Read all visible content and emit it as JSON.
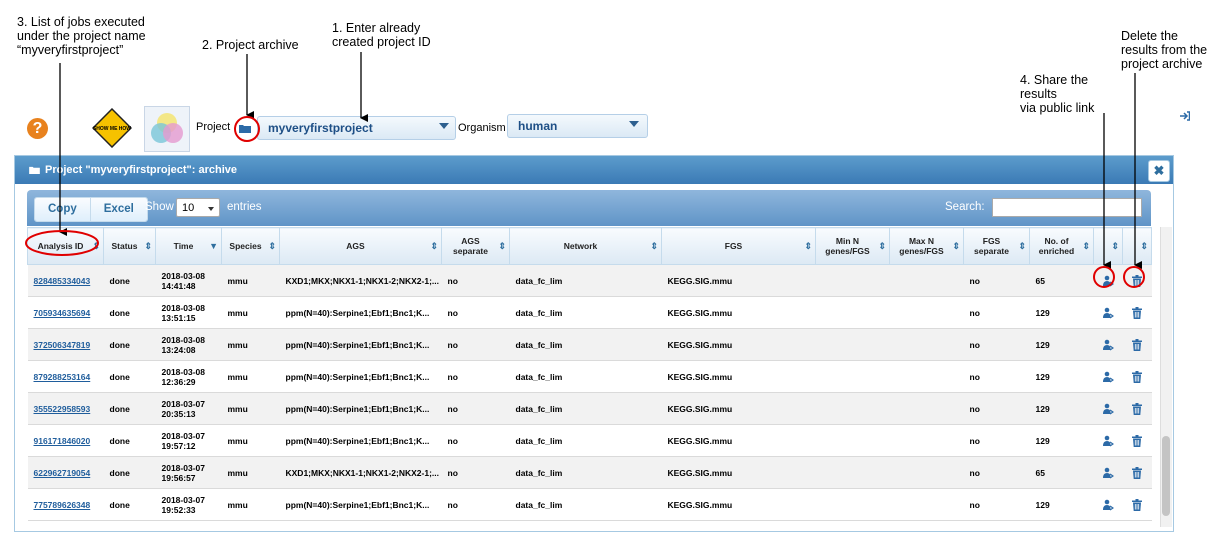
{
  "annotations": {
    "jobs_list": "3. List of jobs  executed\nunder the project name\n“myveryfirstproject”",
    "project_archive": "2. Project archive",
    "enter_id": "1. Enter already\ncreated project ID",
    "share": "4. Share the\nresults\nvia public link",
    "delete": "Delete the\nresults from the\nproject archive"
  },
  "header": {
    "help_glyph": "?",
    "showme_text": "SHOW ME HOW",
    "project_label": "Project",
    "project_value": "myveryfirstproject",
    "organism_label": "Organism",
    "organism_value": "human"
  },
  "dialog": {
    "title": "Project \"myveryfirstproject\": archive",
    "close_glyph": "✖",
    "copy_label": "Copy",
    "excel_label": "Excel",
    "show_label": "Show",
    "page_length": "10",
    "entries_label": "entries",
    "search_label": "Search:",
    "columns": [
      "Analysis ID",
      "Status",
      "Time",
      "Species",
      "AGS",
      "AGS separate",
      "Network",
      "FGS",
      "Min N genes/FGS",
      "Max N genes/FGS",
      "FGS separate",
      "No. of enriched",
      "",
      ""
    ],
    "rows": [
      {
        "id": "828485334043",
        "status": "done",
        "date": "2018-03-08",
        "time": "14:41:48",
        "species": "mmu",
        "ags": "KXD1;MKX;NKX1-1;NKX1-2;NKX2-1;...",
        "ags_sep": "no",
        "network": "data_fc_lim",
        "fgs": "KEGG.SIG.mmu",
        "min": "",
        "max": "",
        "fgs_sep": "no",
        "enriched": "65"
      },
      {
        "id": "705934635694",
        "status": "done",
        "date": "2018-03-08",
        "time": "13:51:15",
        "species": "mmu",
        "ags": "ppm(N=40):Serpine1;Ebf1;Bnc1;K...",
        "ags_sep": "no",
        "network": "data_fc_lim",
        "fgs": "KEGG.SIG.mmu",
        "min": "",
        "max": "",
        "fgs_sep": "no",
        "enriched": "129"
      },
      {
        "id": "372506347819",
        "status": "done",
        "date": "2018-03-08",
        "time": "13:24:08",
        "species": "mmu",
        "ags": "ppm(N=40):Serpine1;Ebf1;Bnc1;K...",
        "ags_sep": "no",
        "network": "data_fc_lim",
        "fgs": "KEGG.SIG.mmu",
        "min": "",
        "max": "",
        "fgs_sep": "no",
        "enriched": "129"
      },
      {
        "id": "879288253164",
        "status": "done",
        "date": "2018-03-08",
        "time": "12:36:29",
        "species": "mmu",
        "ags": "ppm(N=40):Serpine1;Ebf1;Bnc1;K...",
        "ags_sep": "no",
        "network": "data_fc_lim",
        "fgs": "KEGG.SIG.mmu",
        "min": "",
        "max": "",
        "fgs_sep": "no",
        "enriched": "129"
      },
      {
        "id": "355522958593",
        "status": "done",
        "date": "2018-03-07",
        "time": "20:35:13",
        "species": "mmu",
        "ags": "ppm(N=40):Serpine1;Ebf1;Bnc1;K...",
        "ags_sep": "no",
        "network": "data_fc_lim",
        "fgs": "KEGG.SIG.mmu",
        "min": "",
        "max": "",
        "fgs_sep": "no",
        "enriched": "129"
      },
      {
        "id": "916171846020",
        "status": "done",
        "date": "2018-03-07",
        "time": "19:57:12",
        "species": "mmu",
        "ags": "ppm(N=40):Serpine1;Ebf1;Bnc1;K...",
        "ags_sep": "no",
        "network": "data_fc_lim",
        "fgs": "KEGG.SIG.mmu",
        "min": "",
        "max": "",
        "fgs_sep": "no",
        "enriched": "129"
      },
      {
        "id": "622962719054",
        "status": "done",
        "date": "2018-03-07",
        "time": "19:56:57",
        "species": "mmu",
        "ags": "KXD1;MKX;NKX1-1;NKX1-2;NKX2-1;...",
        "ags_sep": "no",
        "network": "data_fc_lim",
        "fgs": "KEGG.SIG.mmu",
        "min": "",
        "max": "",
        "fgs_sep": "no",
        "enriched": "65"
      },
      {
        "id": "775789626348",
        "status": "done",
        "date": "2018-03-07",
        "time": "19:52:33",
        "species": "mmu",
        "ags": "ppm(N=40):Serpine1;Ebf1;Bnc1;K...",
        "ags_sep": "no",
        "network": "data_fc_lim",
        "fgs": "KEGG.SIG.mmu",
        "min": "",
        "max": "",
        "fgs_sep": "no",
        "enriched": "129"
      }
    ]
  },
  "colors": {
    "accent": "#3b7ab5",
    "link": "#1f5d9c",
    "highlight": "#e00000",
    "help": "#e8821e"
  }
}
